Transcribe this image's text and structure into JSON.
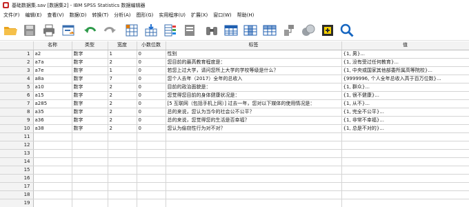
{
  "window": {
    "title": "基础数据集.sav [数据集2] - IBM SPSS Statistics 数据编辑器"
  },
  "menu": [
    "文件(F)",
    "编辑(E)",
    "查看(V)",
    "数据(D)",
    "转换(T)",
    "分析(A)",
    "图形(G)",
    "实用程序(U)",
    "扩展(X)",
    "窗口(W)",
    "帮助(H)"
  ],
  "columns": [
    "名称",
    "类型",
    "宽度",
    "小数位数",
    "标签",
    "值"
  ],
  "rows": [
    {
      "n": "1",
      "name": "a2",
      "type": "数字",
      "width": "1",
      "dec": "0",
      "label": "性别",
      "value": "{1, 男}..."
    },
    {
      "n": "2",
      "name": "a7a",
      "type": "数字",
      "width": "2",
      "dec": "0",
      "label": "您目前的最高教育程度是：",
      "value": "{1, 没有受过任何教育}..."
    },
    {
      "n": "3",
      "name": "a7e",
      "type": "数字",
      "width": "1",
      "dec": "0",
      "label": "若您上过大学，请问您所上大学的学校等级是什么？",
      "value": "{1, 中央或国家其他部委所属高等院校}..."
    },
    {
      "n": "4",
      "name": "a8a",
      "type": "数字",
      "width": "7",
      "dec": "0",
      "label": "您个人去年（2017）全年的总收入",
      "value": "{9999996, 个人全年总收入高于百万位数}..."
    },
    {
      "n": "5",
      "name": "a10",
      "type": "数字",
      "width": "2",
      "dec": "0",
      "label": "目前的政治面貌是：",
      "value": "{1, 群众}..."
    },
    {
      "n": "6",
      "name": "a15",
      "type": "数字",
      "width": "2",
      "dec": "0",
      "label": "您觉得您目前的身体健康状况是：",
      "value": "{1, 很不健康}..."
    },
    {
      "n": "7",
      "name": "a285",
      "type": "数字",
      "width": "2",
      "dec": "0",
      "label": "[5 互联网（包括手机上网）] 过去一年，您对以下媒体的使用情况是：",
      "value": "{1, 从不}..."
    },
    {
      "n": "8",
      "name": "a35",
      "type": "数字",
      "width": "2",
      "dec": "0",
      "label": "总的来说，您认为当今的社会公不公平？",
      "value": "{1, 完全不公平}..."
    },
    {
      "n": "9",
      "name": "a36",
      "type": "数字",
      "width": "2",
      "dec": "0",
      "label": "总的来说，您觉得您的生活是否幸福？",
      "value": "{1, 非常不幸福}..."
    },
    {
      "n": "10",
      "name": "a38",
      "type": "数字",
      "width": "2",
      "dec": "0",
      "label": "您认为偷窃性行为对不对？",
      "value": "{1, 总是不对的}..."
    }
  ],
  "empty_rows": [
    "11",
    "12",
    "13",
    "14",
    "15",
    "16",
    "17",
    "18",
    "19"
  ],
  "colors": {
    "accent": "#1f6fd1",
    "header_bg": "#f3f3f3",
    "grid_line": "#d4d4d4"
  }
}
